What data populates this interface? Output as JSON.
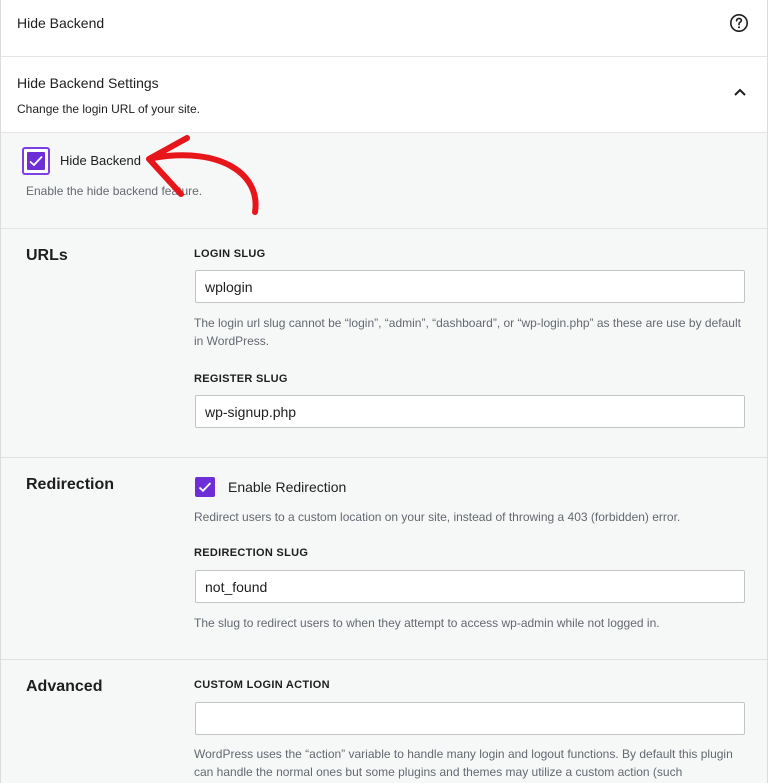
{
  "header": {
    "title": "Hide Backend"
  },
  "settings": {
    "title": "Hide Backend Settings",
    "description": "Change the login URL of your site."
  },
  "hide_backend": {
    "label": "Hide Backend",
    "description": "Enable the hide backend feature.",
    "checked": true
  },
  "urls": {
    "title": "URLs",
    "login_slug": {
      "label": "LOGIN SLUG",
      "value": "wplogin",
      "help": "The login url slug cannot be “login”, “admin”, “dashboard”, or “wp-login.php” as these are use by default in WordPress."
    },
    "register_slug": {
      "label": "REGISTER SLUG",
      "value": "wp-signup.php"
    }
  },
  "redirection": {
    "title": "Redirection",
    "enable_label": "Enable Redirection",
    "enable_checked": true,
    "enable_help": "Redirect users to a custom location on your site, instead of throwing a 403 (forbidden) error.",
    "slug_label": "REDIRECTION SLUG",
    "slug_value": "not_found",
    "slug_help": "The slug to redirect users to when they attempt to access wp-admin while not logged in."
  },
  "advanced": {
    "title": "Advanced",
    "custom_action_label": "CUSTOM LOGIN ACTION",
    "custom_action_value": "",
    "custom_action_help": "WordPress uses the “action” variable to handle many login and logout functions. By default this plugin can handle the normal ones but some plugins and themes may utilize a custom action (such"
  },
  "colors": {
    "accent": "#6d2ed5",
    "annotation_arrow": "#e6161b"
  }
}
